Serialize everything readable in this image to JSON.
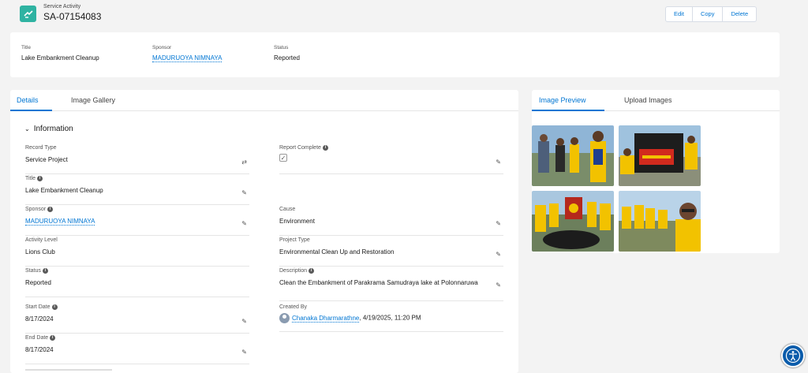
{
  "header": {
    "object_type": "Service Activity",
    "record_name": "SA-07154083",
    "buttons": [
      "Edit",
      "Copy",
      "Delete"
    ],
    "icon": "service-activity-icon"
  },
  "highlights": {
    "title_label": "Title",
    "title_value": "Lake Embankment Cleanup",
    "sponsor_label": "Sponsor",
    "sponsor_value": "MADURUOYA NIMNAYA",
    "status_label": "Status",
    "status_value": "Reported"
  },
  "details": {
    "tabs": [
      "Details",
      "Image Gallery"
    ],
    "section": "Information",
    "left": [
      {
        "label": "Record Type",
        "value": "Service Project"
      },
      {
        "label": "Title",
        "value": "Lake Embankment Cleanup"
      },
      {
        "label": "Sponsor",
        "value": "MADURUOYA NIMNAYA"
      },
      {
        "label": "Activity Level",
        "value": "Lions Club"
      },
      {
        "label": "Status",
        "value": "Reported"
      },
      {
        "label": "Start Date",
        "value": "8/17/2024"
      },
      {
        "label": "End Date",
        "value": "8/17/2024"
      }
    ],
    "right": [
      {
        "label": "Report Complete",
        "value": "✓"
      },
      {
        "label": "Cause",
        "value": "Environment"
      },
      {
        "label": "Project Type",
        "value": "Environmental Clean Up and Restoration"
      },
      {
        "label": "Description",
        "value": "Clean the Embankment of Parakrama Samudraya lake at Polonnaruwa"
      },
      {
        "label": "Created By",
        "value": "Chanaka Dharmarathne",
        "extra": ", 4/19/2025, 11:20 PM"
      }
    ]
  },
  "preview": {
    "tabs": [
      "Image Preview",
      "Upload Images"
    ]
  },
  "colors": {
    "accent": "#0176d3",
    "icon_bg": "#2fb3a2",
    "vest_yellow": "#f2c200"
  }
}
